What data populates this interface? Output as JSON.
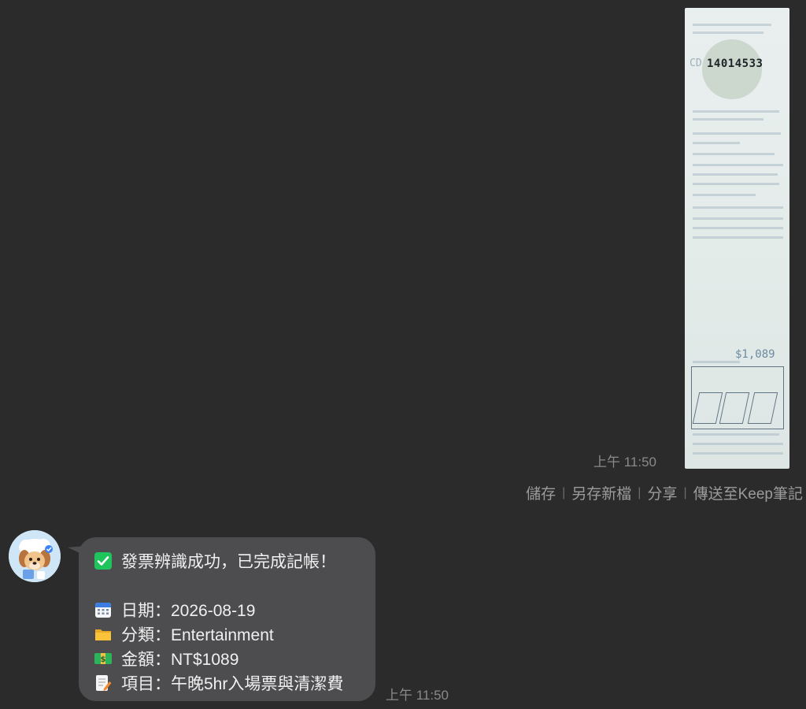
{
  "receipt_image": {
    "invoice_number": "14014533",
    "prefix": "CD",
    "amount": "$1,089"
  },
  "sent_message": {
    "time": "上午 11:50"
  },
  "image_actions": [
    "儲存",
    "另存新檔",
    "分享",
    "傳送至Keep筆記"
  ],
  "bot_message": {
    "status": "發票辨識成功，已完成記帳！",
    "date": "日期：2026-08-19",
    "category": "分類：Entertainment",
    "amount": "金額：NT$1089",
    "item": "項目：午晚5hr入場票與清潔費",
    "time": "上午 11:50",
    "icons": [
      "check-mark-icon",
      "calendar-icon",
      "folder-icon",
      "money-icon",
      "memo-icon"
    ]
  },
  "colors": {
    "background": "#2b2b2c",
    "bubble": "#4d4d4f",
    "check_green": "#1fc55c"
  }
}
